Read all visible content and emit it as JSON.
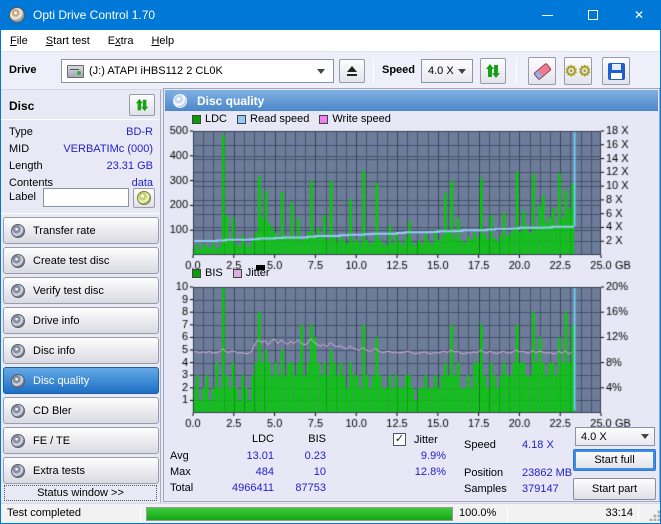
{
  "window": {
    "title": "Opti Drive Control 1.70",
    "close_glyph": "✕"
  },
  "menu": {
    "items": [
      {
        "pre": "",
        "u": "F",
        "post": "ile"
      },
      {
        "pre": "",
        "u": "S",
        "post": "tart test"
      },
      {
        "pre": "E",
        "u": "x",
        "post": "tra"
      },
      {
        "pre": "",
        "u": "H",
        "post": "elp"
      }
    ]
  },
  "toolbar": {
    "drive_label": "Drive",
    "drive_value": "(J:)   ATAPI iHBS112   2 CL0K",
    "speed_label": "Speed",
    "speed_value": "4.0 X"
  },
  "sidebar": {
    "panel_title": "Disc",
    "fields": [
      {
        "label": "Type",
        "value": "BD-R"
      },
      {
        "label": "MID",
        "value": "VERBATIMc (000)"
      },
      {
        "label": "Length",
        "value": "23.31 GB"
      },
      {
        "label": "Contents",
        "value": "data"
      }
    ],
    "label_field": {
      "label": "Label",
      "value": ""
    },
    "buttons": [
      {
        "label": "Transfer rate",
        "active": false
      },
      {
        "label": "Create test disc",
        "active": false
      },
      {
        "label": "Verify test disc",
        "active": false
      },
      {
        "label": "Drive info",
        "active": false
      },
      {
        "label": "Disc info",
        "active": false
      },
      {
        "label": "Disc quality",
        "active": true
      },
      {
        "label": "CD Bler",
        "active": false
      },
      {
        "label": "FE / TE",
        "active": false
      },
      {
        "label": "Extra tests",
        "active": false
      }
    ],
    "status_window_button": "Status window >>"
  },
  "main": {
    "header": "Disc quality",
    "legend1": [
      {
        "label": "LDC",
        "color": "#089C08"
      },
      {
        "label": "Read speed",
        "color": "#92CCF4"
      },
      {
        "label": "Write speed",
        "color": "#F080F0"
      }
    ],
    "legend2": [
      {
        "label": "BIS",
        "color": "#089C08"
      },
      {
        "label": "Jitter",
        "color": "#DCAEDC"
      }
    ],
    "stats": {
      "col_ldc": "LDC",
      "col_bis": "BIS",
      "jitter_label": "Jitter",
      "jitter_checked": true,
      "check_glyph": "✓",
      "rows": [
        {
          "label": "Avg",
          "ldc": "13.01",
          "bis": "0.23",
          "jitter": "9.9%"
        },
        {
          "label": "Max",
          "ldc": "484",
          "bis": "10",
          "jitter": "12.8%"
        },
        {
          "label": "Total",
          "ldc": "4966411",
          "bis": "87753",
          "jitter": ""
        }
      ],
      "right_rows": [
        {
          "label": "Speed",
          "value": "4.18 X"
        },
        {
          "label": "Position",
          "value": "23862 MB"
        },
        {
          "label": "Samples",
          "value": "379147"
        }
      ],
      "speed_select": "4.0 X",
      "start_full": "Start full",
      "start_part": "Start part"
    }
  },
  "statusbar": {
    "text": "Test completed",
    "progress": 100,
    "percent": "100.0%",
    "time": "33:14"
  },
  "chart_data": [
    {
      "type": "bar",
      "title": "LDC errors with read/write speed",
      "xlim": [
        0,
        25
      ],
      "x_minor": 0.625,
      "x_ticks": [
        0,
        2.5,
        5,
        7.5,
        10,
        12.5,
        15,
        17.5,
        20,
        22.5,
        25
      ],
      "x_tick_labels": [
        "0.0",
        "2.5",
        "5.0",
        "7.5",
        "10.0",
        "12.5",
        "15.0",
        "17.5",
        "20.0",
        "22.5",
        "25.0"
      ],
      "x_unit": "GB",
      "left": {
        "max": 500,
        "ticks": [
          100,
          200,
          300,
          400,
          500
        ],
        "labels": [
          "100",
          "200",
          "300",
          "400",
          "500"
        ]
      },
      "right": {
        "max": 18,
        "ticks": [
          2,
          4,
          6,
          8,
          10,
          12,
          14,
          16,
          18
        ],
        "labels": [
          "2 X",
          "4 X",
          "6 X",
          "8 X",
          "10 X",
          "12 X",
          "14 X",
          "16 X",
          "18 X"
        ]
      },
      "bars": {
        "name": "LDC",
        "color": "#00CF00",
        "step": 0.2,
        "values": [
          28,
          45,
          22,
          45,
          35,
          30,
          50,
          25,
          40,
          484,
          160,
          60,
          150,
          45,
          35,
          80,
          45,
          30,
          60,
          90,
          315,
          150,
          260,
          130,
          110,
          90,
          70,
          255,
          80,
          65,
          210,
          75,
          150,
          60,
          70,
          90,
          300,
          80,
          110,
          70,
          160,
          60,
          300,
          75,
          55,
          80,
          60,
          45,
          225,
          55,
          65,
          45,
          340,
          60,
          45,
          55,
          290,
          65,
          45,
          40,
          120,
          45,
          90,
          55,
          40,
          70,
          135,
          50,
          40,
          60,
          45,
          85,
          55,
          45,
          100,
          60,
          75,
          250,
          90,
          300,
          70,
          150,
          60,
          50,
          75,
          60,
          90,
          70,
          310,
          85,
          65,
          160,
          70,
          55,
          80,
          170,
          75,
          90,
          110,
          335,
          95,
          180,
          120,
          90,
          325,
          110,
          200,
          240,
          130,
          150,
          190,
          120,
          330,
          150,
          260,
          185,
          290
        ]
      },
      "line": {
        "name": "Read speed",
        "color": "#92CCF4",
        "width": 2,
        "axis": "right",
        "points": [
          [
            0,
            2.05
          ],
          [
            1.5,
            2.1
          ],
          [
            2,
            2.2
          ],
          [
            3.5,
            2.3
          ],
          [
            4,
            2.4
          ],
          [
            5,
            2.45
          ],
          [
            5.5,
            2.55
          ],
          [
            7,
            2.65
          ],
          [
            7.5,
            2.75
          ],
          [
            9,
            2.85
          ],
          [
            9.5,
            2.95
          ],
          [
            10.5,
            3.0
          ],
          [
            11,
            3.1
          ],
          [
            12.5,
            3.2
          ],
          [
            13,
            3.3
          ],
          [
            14.5,
            3.35
          ],
          [
            15,
            3.45
          ],
          [
            16,
            3.5
          ],
          [
            16.5,
            3.6
          ],
          [
            18,
            3.7
          ],
          [
            18.5,
            3.8
          ],
          [
            19.5,
            3.85
          ],
          [
            20,
            3.95
          ],
          [
            21.5,
            4.0
          ],
          [
            22,
            4.1
          ],
          [
            23.3,
            4.18
          ]
        ]
      },
      "spike": {
        "x": 23.38,
        "from": 4.18,
        "to": 18,
        "color": "#6CCCF8"
      },
      "colors": {
        "bg": "#6C7C99",
        "grid": "#46536B",
        "grid_major": "#394459",
        "border": "#333C4E"
      }
    },
    {
      "type": "bar",
      "title": "BIS errors with jitter",
      "xlim": [
        0,
        25
      ],
      "x_minor": 0.625,
      "x_ticks": [
        0,
        2.5,
        5,
        7.5,
        10,
        12.5,
        15,
        17.5,
        20,
        22.5,
        25
      ],
      "x_tick_labels": [
        "0.0",
        "2.5",
        "5.0",
        "7.5",
        "10.0",
        "12.5",
        "15.0",
        "17.5",
        "20.0",
        "22.5",
        "25.0"
      ],
      "x_unit": "GB",
      "left": {
        "max": 10,
        "ticks": [
          1,
          2,
          3,
          4,
          5,
          6,
          7,
          8,
          9,
          10
        ],
        "labels": [
          "1",
          "2",
          "3",
          "4",
          "5",
          "6",
          "7",
          "8",
          "9",
          "10"
        ]
      },
      "right": {
        "max": 20,
        "ticks": [
          4,
          8,
          12,
          16,
          20
        ],
        "labels": [
          "4%",
          "8%",
          "12%",
          "16%",
          "20%"
        ]
      },
      "bars": {
        "name": "BIS",
        "color": "#00CF00",
        "step": 0.2,
        "values": [
          2,
          3,
          1,
          2,
          3,
          1,
          2,
          4,
          2,
          10,
          3,
          2,
          4,
          2,
          1,
          3,
          2,
          1,
          3,
          4,
          8,
          4,
          5,
          4,
          3,
          4,
          3,
          5,
          3,
          4,
          4,
          3,
          4,
          7,
          3,
          4,
          7,
          6,
          4,
          3,
          4,
          3,
          5,
          4,
          3,
          4,
          3,
          2,
          4,
          3,
          3,
          2,
          7,
          3,
          2,
          3,
          6,
          3,
          2,
          2,
          3,
          2,
          3,
          2,
          2,
          3,
          3,
          2,
          1,
          2,
          2,
          3,
          2,
          2,
          3,
          2,
          3,
          4,
          3,
          7,
          3,
          4,
          2,
          2,
          3,
          2,
          4,
          4,
          7,
          3,
          2,
          4,
          3,
          2,
          3,
          4,
          3,
          3,
          4,
          7,
          4,
          4,
          3,
          3,
          8,
          4,
          6,
          4,
          3,
          4,
          4,
          3,
          6,
          4,
          8,
          4,
          7
        ]
      },
      "line_vals": {
        "name": "Jitter",
        "color": "#DCAEDC",
        "width": 1,
        "step": 0.2,
        "axis": "right",
        "values": [
          9.6,
          9.8,
          9.5,
          9.7,
          9.6,
          9.8,
          9.5,
          9.6,
          9.7,
          10.2,
          9.8,
          9.6,
          9.9,
          9.7,
          9.5,
          9.6,
          9.4,
          9.5,
          9.8,
          11.0,
          11.6,
          11.2,
          11.5,
          10.8,
          11.4,
          11.8,
          11.0,
          11.6,
          11.2,
          10.9,
          11.4,
          11.0,
          11.6,
          11.2,
          10.8,
          11.0,
          11.8,
          11.3,
          10.9,
          10.6,
          10.9,
          10.5,
          11.2,
          10.8,
          10.5,
          10.7,
          10.4,
          10.2,
          10.6,
          10.3,
          10.1,
          9.9,
          10.4,
          10.0,
          9.8,
          9.9,
          10.2,
          9.8,
          9.6,
          9.7,
          9.8,
          9.6,
          9.7,
          9.5,
          9.6,
          9.7,
          9.8,
          9.6,
          9.4,
          9.5,
          9.6,
          9.7,
          9.5,
          9.4,
          9.6,
          9.5,
          9.7,
          9.8,
          9.6,
          10.0,
          9.7,
          9.8,
          9.5,
          9.4,
          9.6,
          9.5,
          9.7,
          9.6,
          10.0,
          9.7,
          9.5,
          9.8,
          9.6,
          9.4,
          9.6,
          9.8,
          9.6,
          9.5,
          9.7,
          10.0,
          9.7,
          9.8,
          9.6,
          9.5,
          9.9,
          9.6,
          9.8,
          9.7,
          9.5,
          9.6,
          9.5,
          9.4,
          9.8,
          9.5,
          9.9,
          9.4,
          9.6
        ]
      },
      "spike": {
        "x": 23.38,
        "from": 0.4,
        "to": 20,
        "color": "#6CCCF8"
      },
      "colors": {
        "bg": "#6C7C99",
        "grid": "#46536B",
        "grid_major": "#394459",
        "border": "#333C4E"
      }
    }
  ]
}
